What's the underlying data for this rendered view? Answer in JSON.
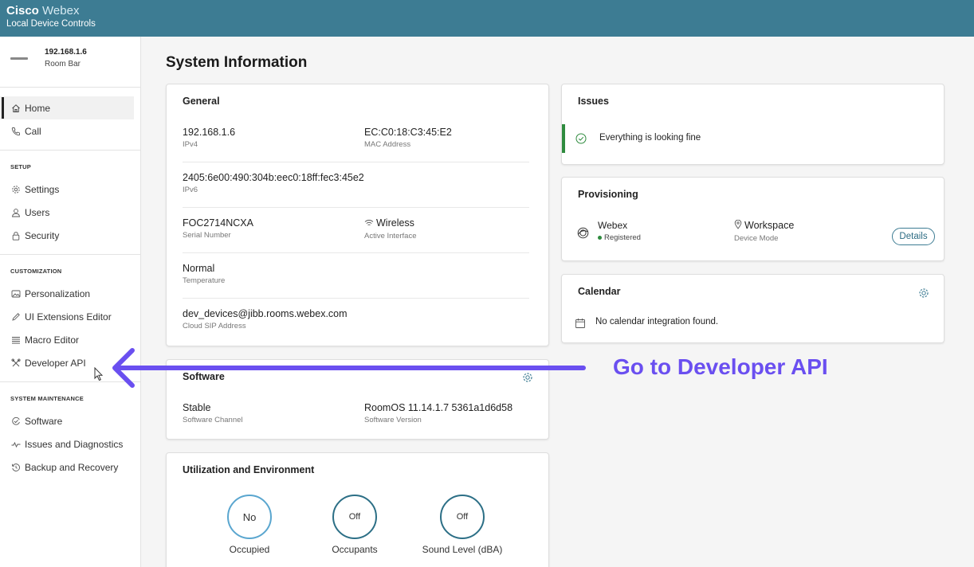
{
  "app": {
    "brand_bold": "Cisco",
    "brand_light": "Webex",
    "subtitle": "Local Device Controls",
    "accent": "#3d7c93"
  },
  "device": {
    "ip": "192.168.1.6",
    "model": "Room Bar"
  },
  "nav": {
    "top": [
      {
        "label": "Home",
        "icon": "home-icon",
        "active": true
      },
      {
        "label": "Call",
        "icon": "phone-icon"
      }
    ],
    "setup": {
      "heading": "SETUP",
      "items": [
        {
          "label": "Settings",
          "icon": "gear-icon"
        },
        {
          "label": "Users",
          "icon": "user-icon"
        },
        {
          "label": "Security",
          "icon": "lock-icon"
        }
      ]
    },
    "customization": {
      "heading": "CUSTOMIZATION",
      "items": [
        {
          "label": "Personalization",
          "icon": "image-icon"
        },
        {
          "label": "UI Extensions Editor",
          "icon": "pen-icon"
        },
        {
          "label": "Macro Editor",
          "icon": "code-lines-icon"
        },
        {
          "label": "Developer API",
          "icon": "tools-icon"
        }
      ]
    },
    "maintenance": {
      "heading": "SYSTEM MAINTENANCE",
      "items": [
        {
          "label": "Software",
          "icon": "software-update-icon"
        },
        {
          "label": "Issues and Diagnostics",
          "icon": "pulse-icon"
        },
        {
          "label": "Backup and Recovery",
          "icon": "restore-icon"
        }
      ]
    }
  },
  "page_title": "System Information",
  "general": {
    "title": "General",
    "ipv4": {
      "value": "192.168.1.6",
      "label": "IPv4"
    },
    "mac": {
      "value": "EC:C0:18:C3:45:E2",
      "label": "MAC Address"
    },
    "ipv6": {
      "value": "2405:6e00:490:304b:eec0:18ff:fec3:45e2",
      "label": "IPv6"
    },
    "serial": {
      "value": "FOC2714NCXA",
      "label": "Serial Number"
    },
    "interface": {
      "value": "Wireless",
      "label": "Active Interface"
    },
    "temperature": {
      "value": "Normal",
      "label": "Temperature"
    },
    "sip": {
      "value": "dev_devices@jibb.rooms.webex.com",
      "label": "Cloud SIP Address"
    }
  },
  "software": {
    "title": "Software",
    "channel": {
      "value": "Stable",
      "label": "Software Channel"
    },
    "version": {
      "value": "RoomOS 11.14.1.7 5361a1d6d58",
      "label": "Software Version"
    }
  },
  "utilization": {
    "title": "Utilization and Environment",
    "gauges": [
      {
        "value": "No",
        "label": "Occupied",
        "active": true
      },
      {
        "value": "Off",
        "label": "Occupants"
      },
      {
        "value": "Off",
        "label": "Sound Level (dBA)"
      }
    ]
  },
  "issues": {
    "title": "Issues",
    "message": "Everything is looking fine",
    "status_color": "#2e8b3e"
  },
  "provisioning": {
    "title": "Provisioning",
    "service": {
      "value": "Webex",
      "status": "Registered"
    },
    "mode": {
      "value": "Workspace",
      "label": "Device Mode"
    },
    "details_label": "Details"
  },
  "calendar": {
    "title": "Calendar",
    "message": "No calendar integration found."
  },
  "annotation": {
    "text": "Go to Developer API",
    "color": "#6a4ff0"
  }
}
